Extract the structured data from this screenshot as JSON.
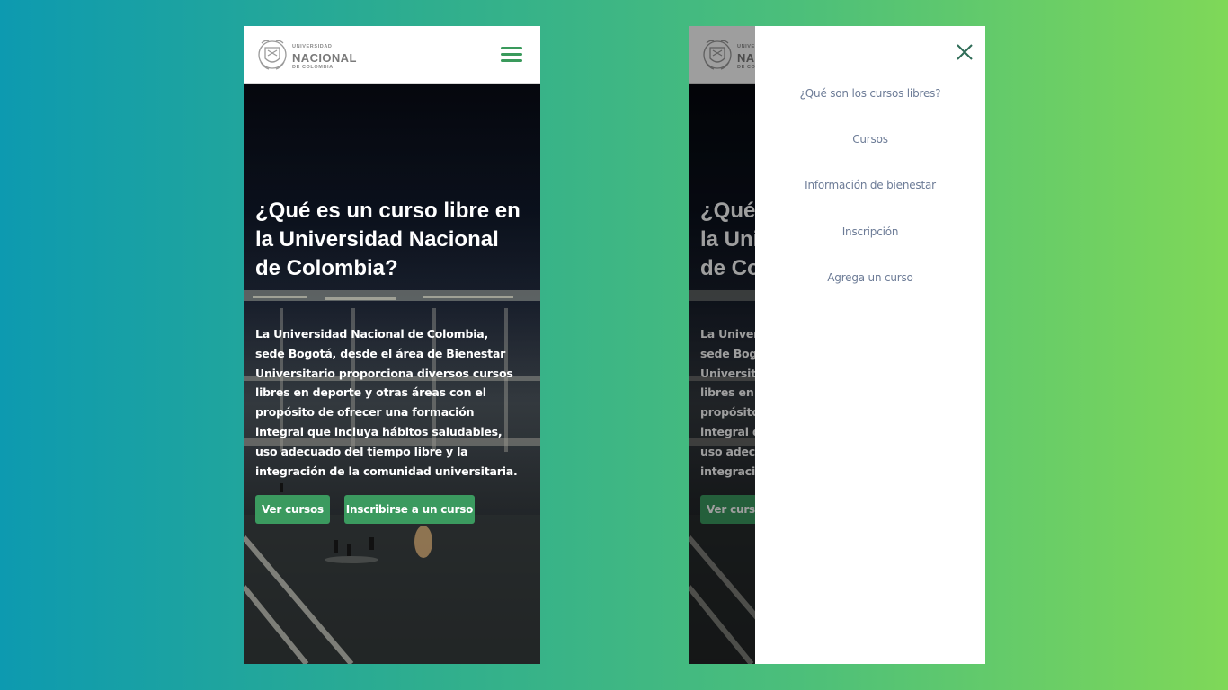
{
  "logo": {
    "line1": "UNIVERSIDAD",
    "line2": "NACIONAL",
    "line3": "DE COLOMBIA"
  },
  "hero": {
    "title": "¿Qué es un curso libre en la Universidad Nacional de Colombia?",
    "description": "La Universidad Nacional de Colombia, sede Bogotá, desde el área de Bienestar Universitario proporciona diversos cursos libres en deporte y otras áreas con el propósito de ofrecer una formación integral que incluya hábitos saludables, uso adecuado del tiempo libre y la integración de la comunidad universitaria.",
    "btn_courses": "Ver cursos",
    "btn_enroll": "Inscribirse a un curso"
  },
  "drawer": {
    "items": [
      "¿Qué son los cursos libres?",
      "Cursos",
      "Información de bienestar",
      "Inscripción",
      "Agrega un curso"
    ]
  },
  "colors": {
    "accent": "#3b9a5f",
    "menu_text": "#6d7c97",
    "close_icon": "#2e6b57"
  },
  "icons": {
    "menu": "hamburger-icon",
    "close": "close-icon",
    "logo": "university-shield-icon"
  }
}
